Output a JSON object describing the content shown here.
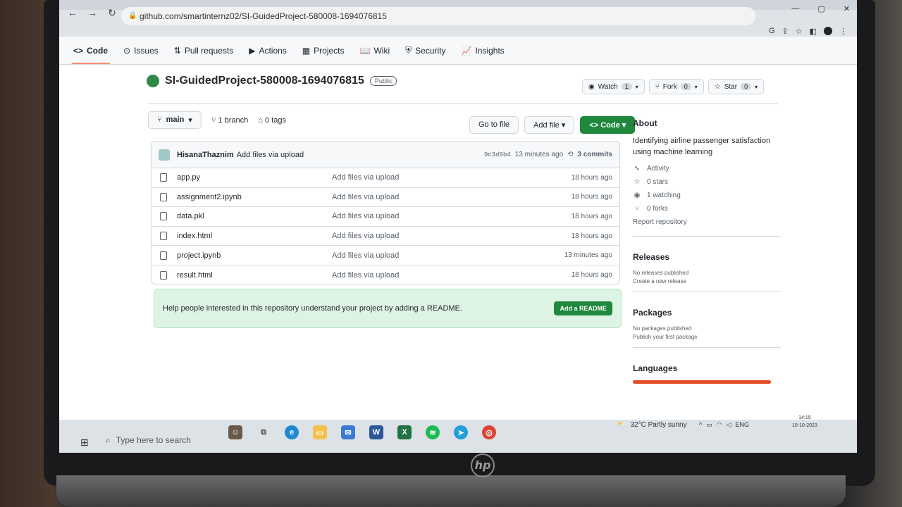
{
  "browser": {
    "url": "github.com/smartinternz02/SI-GuidedProject-580008-1694076815",
    "nav_icons": [
      "back-icon",
      "forward-icon",
      "reload-icon"
    ]
  },
  "repo_nav": [
    {
      "label": "Code",
      "icon": "code-icon",
      "active": true
    },
    {
      "label": "Issues",
      "icon": "issues-icon"
    },
    {
      "label": "Pull requests",
      "icon": "pull-request-icon"
    },
    {
      "label": "Actions",
      "icon": "actions-icon"
    },
    {
      "label": "Projects",
      "icon": "projects-icon"
    },
    {
      "label": "Wiki",
      "icon": "wiki-icon"
    },
    {
      "label": "Security",
      "icon": "security-icon"
    },
    {
      "label": "Insights",
      "icon": "insights-icon"
    }
  ],
  "repo": {
    "name": "SI-GuidedProject-580008-1694076815",
    "visibility": "Public",
    "watch_label": "Watch",
    "watch_count": "1",
    "fork_label": "Fork",
    "fork_count": "0",
    "star_label": "Star",
    "star_count": "0"
  },
  "branch_bar": {
    "branch": "main",
    "branches": "1 branch",
    "tags": "0 tags",
    "go_to_file": "Go to file",
    "add_file": "Add file",
    "code": "Code"
  },
  "commit": {
    "author": "HisanaThaznim",
    "message": "Add files via upload",
    "sha": "9c3d9b4",
    "time": "13 minutes ago",
    "commits": "3 commits"
  },
  "files": [
    {
      "name": "app.py",
      "message": "Add files via upload",
      "time": "18 hours ago"
    },
    {
      "name": "assignment2.ipynb",
      "message": "Add files via upload",
      "time": "18 hours ago"
    },
    {
      "name": "data.pkl",
      "message": "Add files via upload",
      "time": "18 hours ago"
    },
    {
      "name": "index.html",
      "message": "Add files via upload",
      "time": "18 hours ago"
    },
    {
      "name": "project.ipynb",
      "message": "Add files via upload",
      "time": "13 minutes ago"
    },
    {
      "name": "result.html",
      "message": "Add files via upload",
      "time": "18 hours ago"
    }
  ],
  "readme": {
    "text": "Help people interested in this repository understand your project by adding a README.",
    "button": "Add a README"
  },
  "about": {
    "heading": "About",
    "description": "Identifying airline passenger satisfaction using machine learning",
    "activity": "Activity",
    "stars": "0 stars",
    "watching": "1 watching",
    "forks": "0 forks",
    "report": "Report repository"
  },
  "releases": {
    "heading": "Releases",
    "line1": "No releases published",
    "line2": "Create a new release"
  },
  "packages": {
    "heading": "Packages",
    "line1": "No packages published",
    "line2": "Publish your first package"
  },
  "languages": {
    "heading": "Languages",
    "bar_color": "#e34c26"
  },
  "taskbar": {
    "search_placeholder": "Type here to search",
    "weather": "32°C  Partly sunny",
    "lang": "ENG",
    "time": "14:15",
    "date": "10-10-2023"
  },
  "colors": {
    "accent_green": "#1f883d",
    "nav_underline": "#fd8c73"
  },
  "laptop_brand": "hp"
}
